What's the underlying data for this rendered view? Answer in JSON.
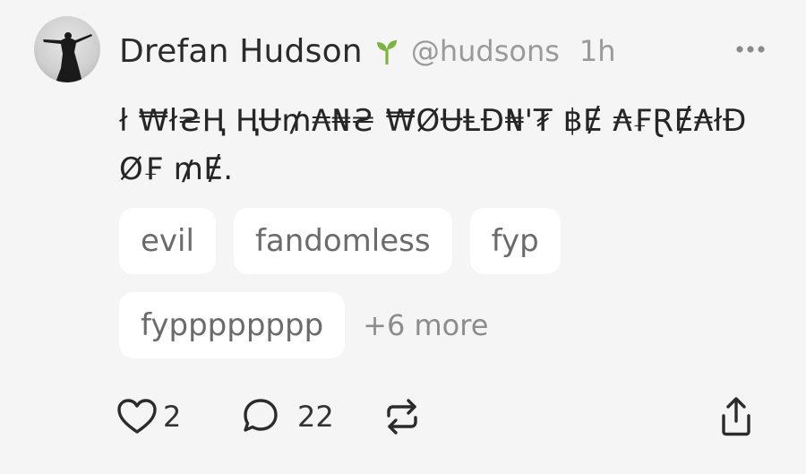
{
  "post": {
    "author": {
      "name": "Drefan Hudson",
      "handle": "@hudsons",
      "badge_icon": "sprout-icon",
      "avatar_icon": "silhouette-avatar"
    },
    "time": "1h",
    "text": "ł ₩ł₴Ⱨ ⱧɄ₥₳₦₴ ₩ØɄⱠĐ₦'₮ ฿Ɇ ₳₣ⱤɆ₳łĐ\nØ₣ ₥Ɇ.",
    "tags": {
      "row1": [
        "evil",
        "fandomless",
        "fyp"
      ],
      "row2": [
        "fypppppppp"
      ],
      "more_label": "+6 more"
    },
    "actions": {
      "likes": "2",
      "comments": "22",
      "icons": [
        "heart-icon",
        "comment-icon",
        "repost-icon",
        "share-icon"
      ]
    },
    "menu_icon": "more-horizontal-icon"
  },
  "colors": {
    "background": "#f5f5f5",
    "tag_background": "#ffffff",
    "sprout_green": "#7cb342",
    "muted_text": "#9a9a9a"
  }
}
